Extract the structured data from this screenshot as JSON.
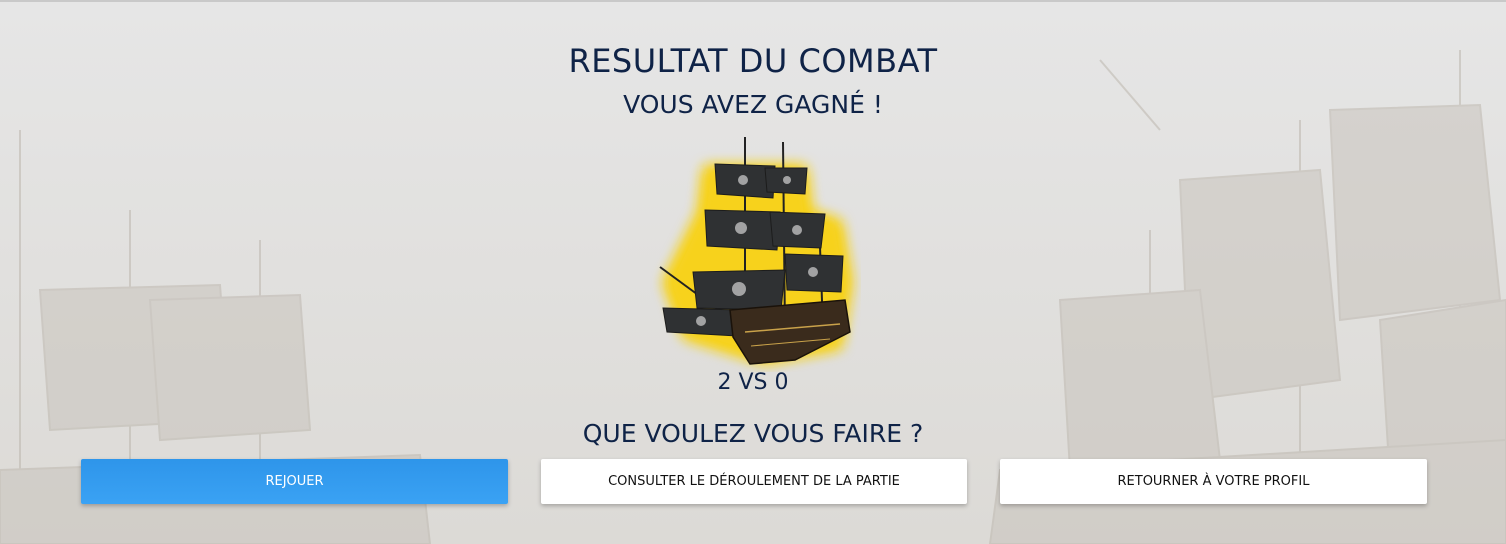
{
  "result": {
    "title": "RESULTAT DU COMBAT",
    "subtitle": "VOUS AVEZ GAGNÉ !",
    "score": "2 VS 0",
    "question": "QUE VOULEZ VOUS FAIRE ?"
  },
  "actions": {
    "replay_label": "REJOUER",
    "log_label": "CONSULTER LE DÉROULEMENT DE LA PARTIE",
    "profile_label": "RETOURNER À VOTRE PROFIL"
  },
  "colors": {
    "heading": "#0f2347",
    "primary": "#3aa2f4",
    "glow": "#f7d21a"
  },
  "icons": {
    "ship": "pirate-ship-icon"
  }
}
